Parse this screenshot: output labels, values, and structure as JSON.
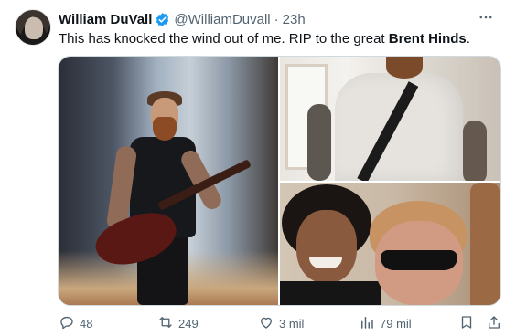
{
  "author": {
    "name": "William DuVall",
    "handle": "@WilliamDuvall",
    "separator": "·",
    "time": "23h",
    "verified_color": "#1d9bf0"
  },
  "tweet": {
    "text": "This has knocked the wind out of me. RIP to the great ",
    "bold_text": "Brent Hinds",
    "text_end": "."
  },
  "actions": {
    "replies": "48",
    "reposts": "249",
    "likes": "3 mil",
    "views": "79 mil"
  },
  "icons": [
    "more-icon",
    "verified-icon",
    "reply-icon",
    "repost-icon",
    "like-icon",
    "views-icon",
    "bookmark-icon",
    "share-icon"
  ]
}
